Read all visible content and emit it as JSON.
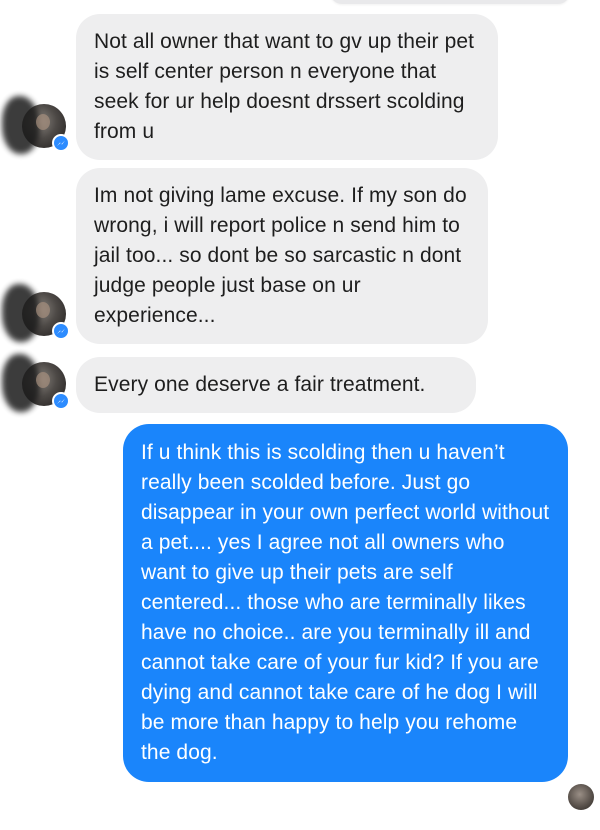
{
  "conversation": {
    "messages": [
      {
        "sender": "other",
        "text": "Not all owner that want to gv up their pet is self center person n everyone that seek for ur help doesnt drssert scolding from u"
      },
      {
        "sender": "other",
        "text": "Im not giving lame excuse. If my son do wrong, i will report police n send him to jail too... so dont be so sarcastic n dont judge people just base on ur experience..."
      },
      {
        "sender": "other",
        "text": "Every one deserve a fair treatment."
      },
      {
        "sender": "me",
        "text": "If u think this is scolding then u haven’t really been scolded before.  Just go disappear in your own perfect world without a pet.... yes I agree not all owners who want to give up their pets are self centered... those who are terminally likes have no choice.. are you terminally ill and cannot take care of your fur kid? If you are dying and cannot take care of he dog I will be more than happy to help you rehome the dog."
      }
    ]
  },
  "icons": {
    "contact_avatar": "avatar",
    "messenger_badge": "messenger-icon",
    "self_avatar": "avatar"
  },
  "colors": {
    "incoming_bubble": "#eeeeef",
    "outgoing_bubble": "#1a85fb",
    "badge": "#2d8cff"
  }
}
